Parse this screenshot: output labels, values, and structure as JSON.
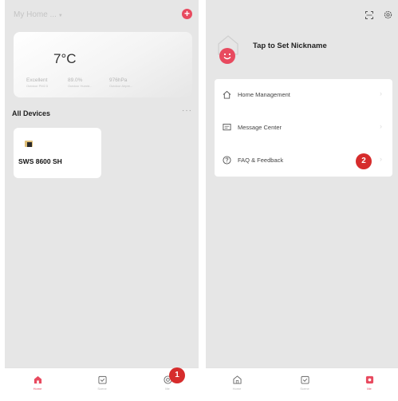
{
  "colors": {
    "accent": "#e84a5f",
    "callout": "#d62c2c",
    "background": "#e6e6e6"
  },
  "left": {
    "home_title": "My Home ...",
    "home_dropdown_icon": "caret-down-icon",
    "add_icon": "plus-icon",
    "weather": {
      "temperature": "7°C",
      "stats": [
        {
          "value": "Excellent",
          "label": "Outdoor PM2.5"
        },
        {
          "value": "89.0%",
          "label": "Outdoor Humid..."
        },
        {
          "value": "976hPa",
          "label": "Outdoor Airpre..."
        }
      ]
    },
    "section_title": "All Devices",
    "more_icon": "more-dots-icon",
    "device": {
      "name": "SWS 8600 SH",
      "icon": "weather-station-icon"
    },
    "tabs": [
      {
        "label": "Home",
        "icon": "home-icon",
        "active": true
      },
      {
        "label": "Scene",
        "icon": "scene-icon",
        "active": false
      },
      {
        "label": "Me",
        "icon": "me-icon",
        "active": false
      }
    ],
    "callout": "1"
  },
  "right": {
    "scan_icon": "scan-icon",
    "settings_icon": "settings-icon",
    "nickname": "Tap to Set Nickname",
    "menu": [
      {
        "label": "Home Management",
        "icon": "home-outline-icon"
      },
      {
        "label": "Message Center",
        "icon": "message-icon"
      },
      {
        "label": "FAQ & Feedback",
        "icon": "help-icon"
      }
    ],
    "tabs": [
      {
        "label": "Home",
        "icon": "home-icon",
        "active": false
      },
      {
        "label": "Scene",
        "icon": "scene-icon",
        "active": false
      },
      {
        "label": "Me",
        "icon": "me-icon",
        "active": true
      }
    ],
    "callout": "2"
  }
}
